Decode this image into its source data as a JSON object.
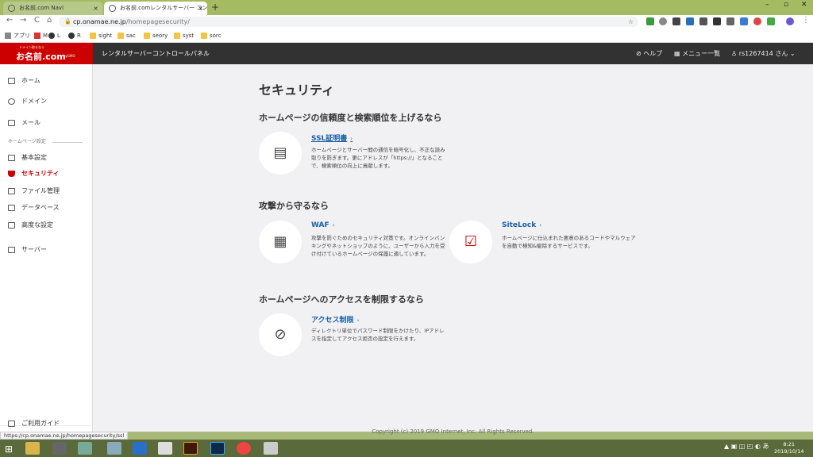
{
  "browser": {
    "tabs": [
      {
        "title": "お名前.com Navi",
        "close": "×"
      },
      {
        "title": "お名前.comレンタルサーバー コントロ",
        "close": "×"
      }
    ],
    "new_tab": "+",
    "window_controls": {
      "minimize": "–",
      "maximize": "▫",
      "close": "✕"
    },
    "nav": {
      "back": "←",
      "forward": "→",
      "reload": "C",
      "home": "⌂"
    },
    "address": {
      "host": "cp.onamae.ne.jp",
      "path": "/homepagesecurity/",
      "lock": "🔒",
      "star": "☆"
    },
    "menu": "⋮",
    "bookmarks": [
      {
        "label": "アプリ",
        "icon": "apps-icon"
      },
      {
        "label": "M",
        "icon": "gmail-icon"
      },
      {
        "label": "L",
        "icon": "globe-icon"
      },
      {
        "label": "R",
        "icon": "globe-icon"
      },
      {
        "label": "sight",
        "icon": "folder-icon"
      },
      {
        "label": "sac",
        "icon": "folder-icon"
      },
      {
        "label": "seory",
        "icon": "folder-icon"
      },
      {
        "label": "syst",
        "icon": "folder-icon"
      },
      {
        "label": "sorc",
        "icon": "folder-icon"
      }
    ],
    "status_url": "https://cp.onamae.ne.jp/homepagesecurity/ssl"
  },
  "header": {
    "logo_sub": "ドメイン取るなら",
    "logo_main": "お名前.com",
    "logo_tag": "byGMO",
    "title": "レンタルサーバーコントロールパネル",
    "help": "ヘルプ",
    "menu_list": "メニュー一覧",
    "user": "rs1267414 さん ⌄"
  },
  "sidebar": {
    "items": [
      {
        "label": "ホーム",
        "icon": "home-icon"
      },
      {
        "label": "ドメイン",
        "icon": "globe-icon"
      },
      {
        "label": "メール",
        "icon": "mail-icon"
      },
      {
        "label": "基本設定",
        "icon": "monitor-icon"
      },
      {
        "label": "セキュリティ",
        "icon": "shield-icon",
        "active": true
      },
      {
        "label": "ファイル管理",
        "icon": "upload-icon"
      },
      {
        "label": "データベース",
        "icon": "database-icon"
      },
      {
        "label": "高度な設定",
        "icon": "settings-icon"
      },
      {
        "label": "サーバー",
        "icon": "server-icon"
      }
    ],
    "section_caption": "ホームページ設定",
    "guide": "ご利用ガイド"
  },
  "main": {
    "title": "セキュリティ",
    "sections": [
      {
        "heading": "ホームページの信頼度と検索順位を上げるなら",
        "cards": [
          {
            "title": "SSL証明書",
            "arrow": "›",
            "icon": "certificate-icon",
            "desc": "ホームページとサーバー間の通信を暗号化し、不正な読み取りを防ぎます。更にアドレスが「https://」となることで、検索順位の向上に貢献します。"
          }
        ]
      },
      {
        "heading": "攻撃から守るなら",
        "cards": [
          {
            "title": "WAF",
            "arrow": "›",
            "icon": "firewall-icon",
            "desc": "攻撃を防ぐためのセキュリティ対策です。オンラインバンキングやネットショップのように、ユーザーから入力を受け付けているホームページの保護に適しています。"
          },
          {
            "title": "SiteLock",
            "arrow": "›",
            "icon": "lock-check-icon",
            "desc": "ホームページに仕込まれた悪意のあるコードやマルウェアを自動で検知&駆除するサービスです。"
          }
        ]
      },
      {
        "heading": "ホームページへのアクセスを制限するなら",
        "cards": [
          {
            "title": "アクセス制限",
            "arrow": "›",
            "icon": "prohibited-icon",
            "desc": "ディレクトリ単位でパスワード制限をかけたり、IPアドレスを指定してアクセス拒否の設定を行えます。"
          }
        ]
      }
    ],
    "footer": "Copyright (c) 2019 GMO Internet, Inc. All Rights Reserved."
  },
  "taskbar": {
    "start": "⊞",
    "tray": "▲ ▣ ◫ ◰ ◐ あ",
    "time": "8:21",
    "date": "2019/10/14"
  },
  "colors": {
    "accent": "#cc0000",
    "link": "#1a5fa8",
    "header_bg": "#323232"
  }
}
